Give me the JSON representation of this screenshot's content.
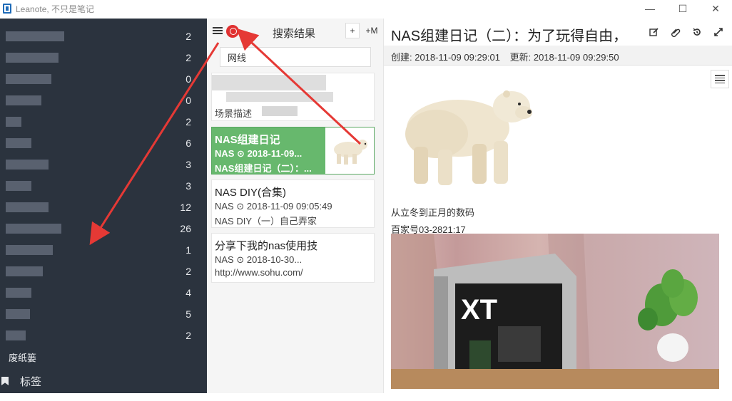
{
  "window": {
    "title": "Leanote, 不只是笔记",
    "min_glyph": "—",
    "max_glyph": "☐",
    "close_glyph": "✕"
  },
  "sidebar": {
    "notebooks": [
      {
        "count": "2"
      },
      {
        "count": "2"
      },
      {
        "count": "0"
      },
      {
        "count": "0"
      },
      {
        "count": "2"
      },
      {
        "count": "6"
      },
      {
        "count": "3"
      },
      {
        "count": "3"
      },
      {
        "count": "12"
      },
      {
        "count": "26"
      },
      {
        "count": "1"
      },
      {
        "count": "2"
      },
      {
        "count": "4"
      },
      {
        "count": "5"
      },
      {
        "count": "2"
      }
    ],
    "trash_label": "废纸篓",
    "tags_label": "标签"
  },
  "notelist": {
    "title": "搜索结果",
    "add_label": "+",
    "add_md_label": "+M",
    "search_value": "网线",
    "notes": [
      {
        "title": "",
        "meta": "",
        "desc": "场景描述",
        "active": false
      },
      {
        "title": "NAS组建日记",
        "meta": "NAS ⊙ 2018-11-09...",
        "desc": "NAS组建日记（二）：...",
        "active": true
      },
      {
        "title": "NAS DIY(合集)",
        "meta": "NAS ⊙ 2018-11-09 09:05:49",
        "desc": "NAS DIY（一）自己弄家",
        "active": false
      },
      {
        "title": "分享下我的nas使用技",
        "meta": "NAS ⊙ 2018-10-30...",
        "desc": "http://www.sohu.com/",
        "active": false
      }
    ]
  },
  "editor": {
    "title": "NAS组建日记（二）：为了玩得自由，",
    "created": "创建: 2018-11-09 09:29:01",
    "updated": "更新: 2018-11-09 09:29:50",
    "line1": "从立冬到正月的数码",
    "line2": "百家号03-2821:17",
    "photo_text": "XT"
  },
  "colors": {
    "sidebar_bg": "#2b333e",
    "active_note": "#67b86d",
    "annotation_red": "#e53935"
  }
}
